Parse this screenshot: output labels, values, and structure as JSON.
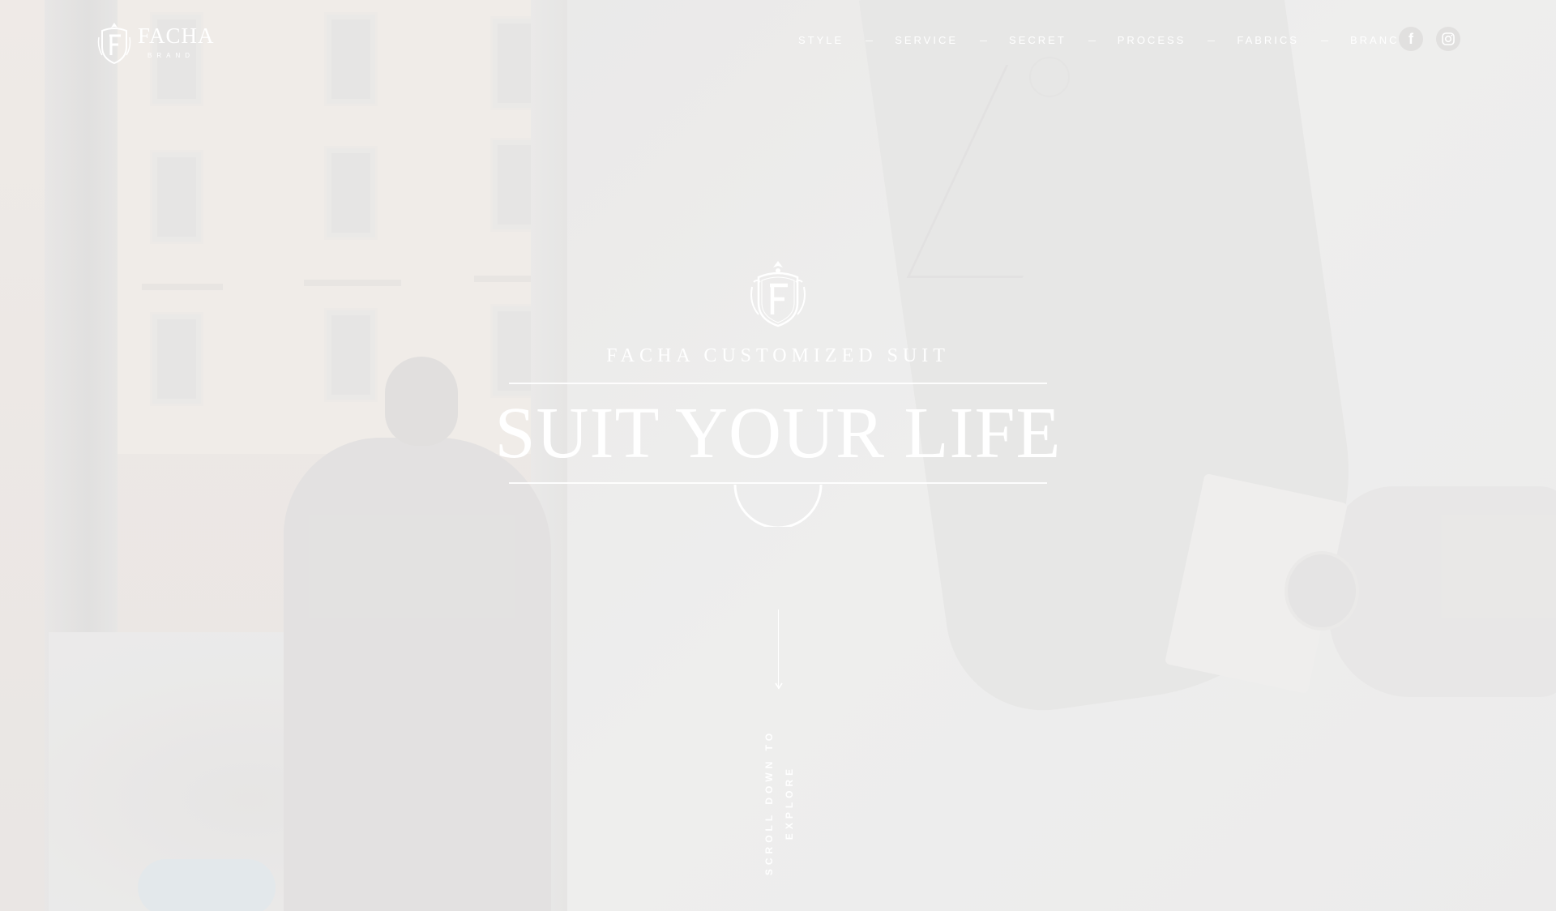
{
  "header": {
    "logo": {
      "name": "FACHA",
      "subtitle": "BRAND",
      "icon": "crest-f-icon"
    },
    "nav": [
      {
        "label": "STYLE"
      },
      {
        "label": "SERVICE"
      },
      {
        "label": "SECRET"
      },
      {
        "label": "PROCESS"
      },
      {
        "label": "FABRICS"
      },
      {
        "label": "BRANCH"
      }
    ],
    "social": [
      {
        "icon": "facebook-icon",
        "glyph": "f"
      },
      {
        "icon": "instagram-icon"
      }
    ]
  },
  "hero": {
    "crest_icon": "crest-f-icon",
    "tagline": "FACHA CUSTOMIZED SUIT",
    "headline": "SUIT YOUR LIFE"
  },
  "scroll": {
    "text": "SCROLL DOWN TO EXPLORE",
    "icon": "arrow-down-icon"
  },
  "colors": {
    "text": "#ffffff",
    "background": "#ebeaea",
    "social_circle": "#e1e0df"
  }
}
